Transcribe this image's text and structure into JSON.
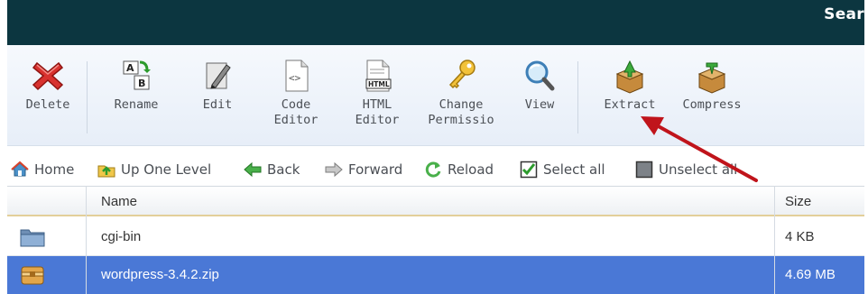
{
  "header": {
    "search_text": "Sear"
  },
  "toolbar": {
    "delete": "Delete",
    "rename": "Rename",
    "edit": "Edit",
    "code_editor_1": "Code",
    "code_editor_2": "Editor",
    "html_editor_1": "HTML",
    "html_editor_2": "Editor",
    "change_perm_1": "Change",
    "change_perm_2": "Permissio",
    "view": "View",
    "extract": "Extract",
    "compress": "Compress",
    "html_badge": "HTML"
  },
  "nav": {
    "home": "Home",
    "up_one_level": "Up One Level",
    "back": "Back",
    "forward": "Forward",
    "reload": "Reload",
    "select_all": "Select all",
    "unselect_all": "Unselect all"
  },
  "table": {
    "headers": {
      "name": "Name",
      "size": "Size"
    },
    "rows": [
      {
        "name": "cgi-bin",
        "size": "4 KB",
        "type": "folder-icon"
      },
      {
        "name": "wordpress-3.4.2.zip",
        "size": "4.69 MB",
        "type": "archive-icon",
        "selected": true
      }
    ]
  },
  "colors": {
    "banner": "#0c3640",
    "selected_row": "#4a78d6",
    "arrow": "#c0141b"
  }
}
